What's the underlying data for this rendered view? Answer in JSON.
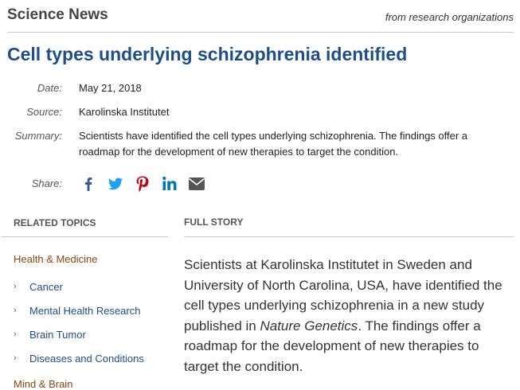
{
  "header": {
    "site_name": "Science News",
    "tagline": "from research organizations"
  },
  "article": {
    "title": "Cell types underlying schizophrenia identified",
    "meta": {
      "date_label": "Date:",
      "date": "May 21, 2018",
      "source_label": "Source:",
      "source": "Karolinska Institutet",
      "summary_label": "Summary:",
      "summary": "Scientists have identified the cell types underlying schizophrenia. The findings offer a roadmap for the development of new therapies to target the condition.",
      "share_label": "Share:"
    },
    "share_icons": [
      "facebook-icon",
      "twitter-icon",
      "pinterest-icon",
      "linkedin-icon",
      "email-icon"
    ]
  },
  "related": {
    "heading": "RELATED TOPICS",
    "category": "Health & Medicine",
    "items": [
      "Cancer",
      "Mental Health Research",
      "Brain Tumor",
      "Diseases and Conditions"
    ],
    "next_category": "Mind & Brain"
  },
  "story": {
    "heading": "FULL STORY",
    "text_before": "Scientists at Karolinska Institutet in Sweden and University of North Carolina, USA, have identified the cell types underlying schizophrenia in a new study published in ",
    "journal": "Nature Genetics",
    "text_after": ". The findings offer a roadmap for the development of new therapies to target the condition."
  },
  "colors": {
    "title_blue": "#1d4e8a",
    "category_brown": "#8a4510",
    "facebook": "#3b5998",
    "twitter": "#1da1f2",
    "pinterest": "#bd081c",
    "linkedin": "#0077b5",
    "email": "#555555"
  }
}
